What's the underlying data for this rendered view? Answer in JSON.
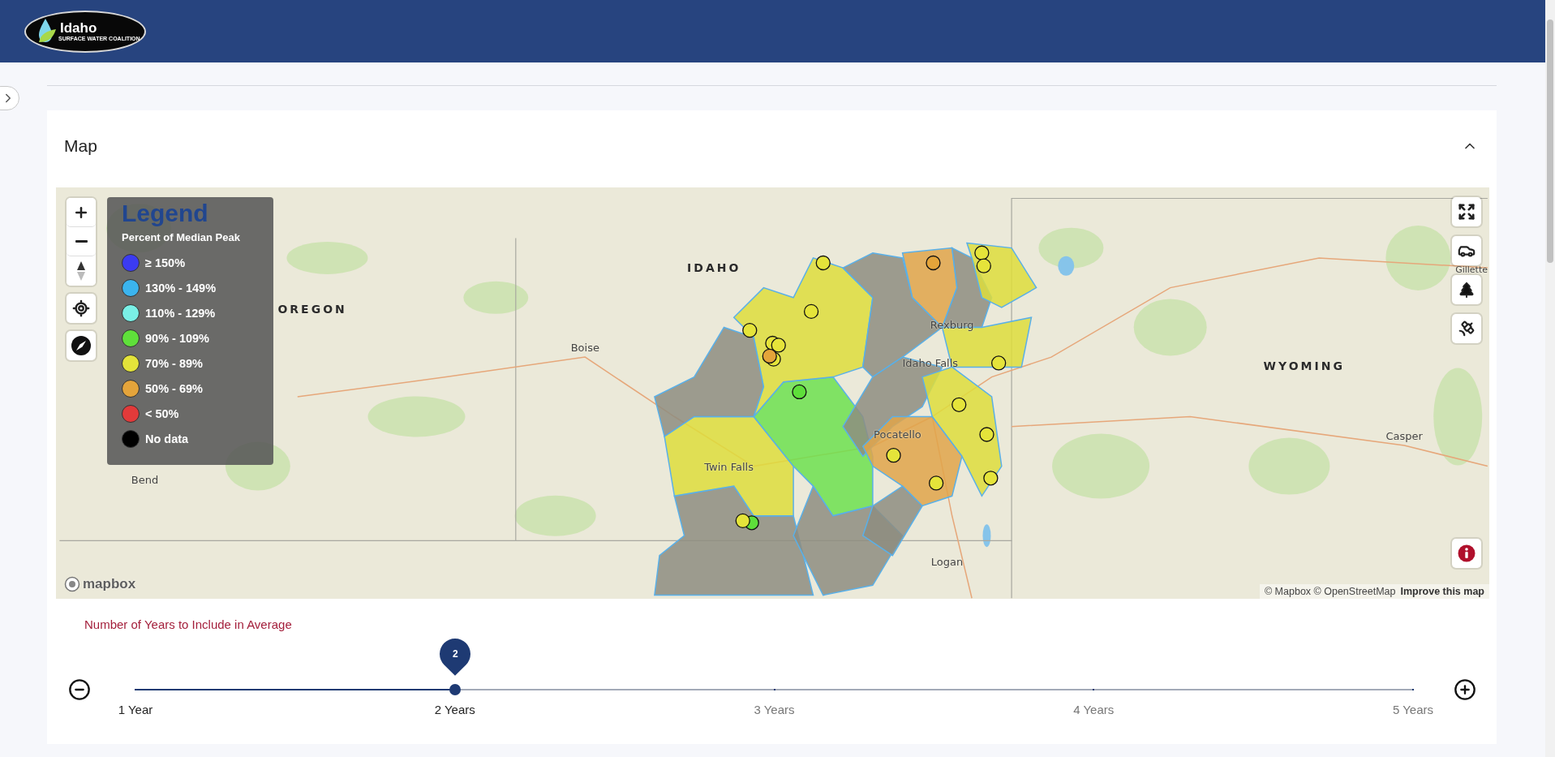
{
  "header": {
    "logo": {
      "title": "Idaho",
      "subtitle": "SURFACE WATER COALITION"
    }
  },
  "card": {
    "title": "Map",
    "expanded": true
  },
  "map": {
    "labels": [
      {
        "text": "Bend",
        "kind": "city"
      },
      {
        "text": "OREGON",
        "kind": "state"
      },
      {
        "text": "IDAHO",
        "kind": "state"
      },
      {
        "text": "Boise",
        "kind": "city"
      },
      {
        "text": "Rexburg",
        "kind": "city"
      },
      {
        "text": "Idaho Falls",
        "kind": "city"
      },
      {
        "text": "WYOMING",
        "kind": "state"
      },
      {
        "text": "Pocatello",
        "kind": "city"
      },
      {
        "text": "Twin Falls",
        "kind": "city"
      },
      {
        "text": "Casper",
        "kind": "city"
      },
      {
        "text": "Logan",
        "kind": "city"
      },
      {
        "text": "Gillette",
        "kind": "city"
      }
    ],
    "legend": {
      "title": "Legend",
      "subtitle": "Percent of Median Peak",
      "items": [
        {
          "label": "≥ 150%",
          "color": "#3b3bf2"
        },
        {
          "label": "130% - 149%",
          "color": "#3bb4ee"
        },
        {
          "label": "110% - 129%",
          "color": "#7af0e6"
        },
        {
          "label": "90% - 109%",
          "color": "#5fe03a"
        },
        {
          "label": "70% - 89%",
          "color": "#e3e33a"
        },
        {
          "label": "50% - 69%",
          "color": "#e4a43b"
        },
        {
          "label": "< 50%",
          "color": "#e23a3a"
        },
        {
          "label": "No data",
          "color": "#000000"
        }
      ]
    },
    "brand": "mapbox",
    "attribution": "© Mapbox © OpenStreetMap",
    "improve_link": "Improve this map"
  },
  "slider": {
    "label": "Number of Years to Include in Average",
    "value": "2",
    "level": 0.25,
    "marks": [
      "1 Year",
      "2 Years",
      "3 Years",
      "4 Years",
      "5 Years"
    ]
  }
}
